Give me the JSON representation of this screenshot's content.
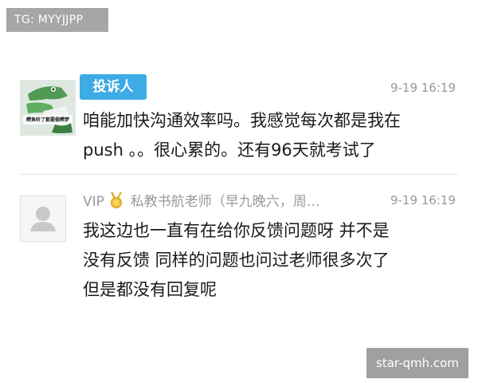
{
  "top_tag": "TG: MYYJJPP",
  "comments": [
    {
      "badge": "投诉人",
      "timestamp": "9-19 16:19",
      "avatar_icon": "cartoon-crocodile-avatar",
      "avatar_caption": "鳄鱼听了都要做鳄梦",
      "lines": [
        "咱能加快沟通效率吗。我感觉每次都是我在",
        "push 。。很心累的。还有96天就考试了"
      ]
    },
    {
      "vip_label": "VIP",
      "medal_icon": "gold-medal-icon",
      "sender_name": "私教书航老师（早九晚六，周…",
      "timestamp": "9-19 16:19",
      "avatar_icon": "default-user-avatar",
      "lines": [
        "我这边也一直有在给你反馈问题呀 并不是",
        "没有反馈  同样的问题也问过老师很多次了",
        "但是都没有回复呢"
      ]
    }
  ],
  "watermark": "star-qmh.com"
}
